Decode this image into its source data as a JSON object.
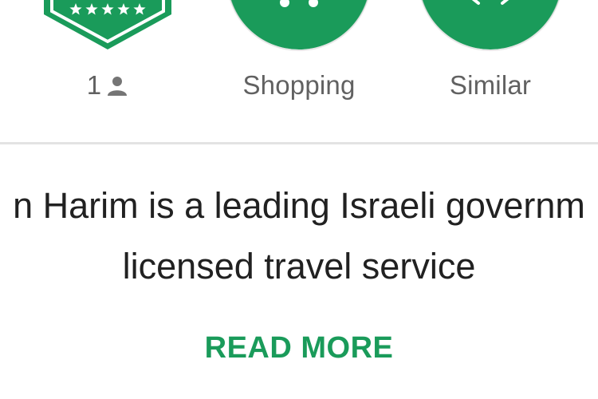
{
  "badges": {
    "rating": {
      "count": "1",
      "icon": "person-icon",
      "star_icon": "star-icon",
      "star_count": 5
    },
    "category": {
      "label": "Shopping",
      "icon": "shopping-cart-icon"
    },
    "similar": {
      "label": "Similar",
      "icon": "similar-apps-icon"
    }
  },
  "description": {
    "line1": "n Harim is a leading Israeli governm",
    "line2": "licensed travel service"
  },
  "actions": {
    "read_more": "READ MORE"
  },
  "colors": {
    "accent": "#1a9b5a",
    "label_text": "#616161",
    "body_text": "#212121",
    "divider": "#e3e3e3"
  }
}
